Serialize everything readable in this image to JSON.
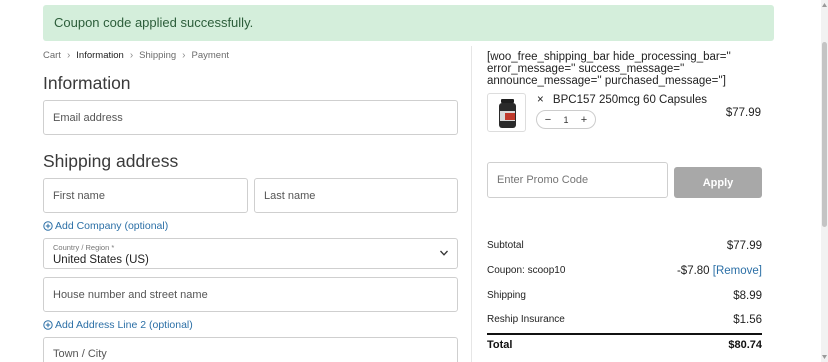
{
  "notice": {
    "text": "Coupon code applied successfully."
  },
  "breadcrumb": [
    {
      "label": "Cart"
    },
    {
      "label": "Information"
    },
    {
      "label": "Shipping"
    },
    {
      "label": "Payment"
    }
  ],
  "information": {
    "heading": "Information",
    "email_placeholder": "Email address"
  },
  "shipping": {
    "heading": "Shipping address",
    "first_name_placeholder": "First name",
    "last_name_placeholder": "Last name",
    "add_company_label": "Add Company (optional)",
    "country_label": "Country / Region *",
    "country_value": "United States (US)",
    "street_placeholder": "House number and street name",
    "add_address2_label": "Add Address Line 2 (optional)",
    "city_placeholder": "Town / City"
  },
  "sidebar": {
    "shortcode_text": "[woo_free_shipping_bar hide_processing_bar='' error_message='' success_message='' announce_message='' purchased_message='']",
    "product": {
      "quantity_multiplier": "×",
      "name": "BPC157 250mcg 60 Capsules",
      "price": "$77.99",
      "quantity": "1",
      "minus": "−",
      "plus": "+"
    },
    "promo": {
      "placeholder": "Enter Promo Code",
      "apply_label": "Apply"
    },
    "summary": {
      "subtotal_label": "Subtotal",
      "subtotal_value": "$77.99",
      "coupon_label": "Coupon: scoop10",
      "coupon_value": "-$7.80",
      "coupon_remove": "[Remove]",
      "shipping_label": "Shipping",
      "shipping_value": "$8.99",
      "insurance_label": "Reship Insurance",
      "insurance_value": "$1.56",
      "total_label": "Total",
      "total_value": "$80.74"
    }
  },
  "colors": {
    "notice_bg": "#d4eedb",
    "link": "#2b6fa6",
    "apply_button": "#a8a8a8"
  },
  "icons": {
    "add_company": "plus-circle-icon",
    "add_address2": "plus-circle-icon",
    "country_select": "chevron-down-icon",
    "breadcrumb_separator": "chevron-right-icon"
  }
}
